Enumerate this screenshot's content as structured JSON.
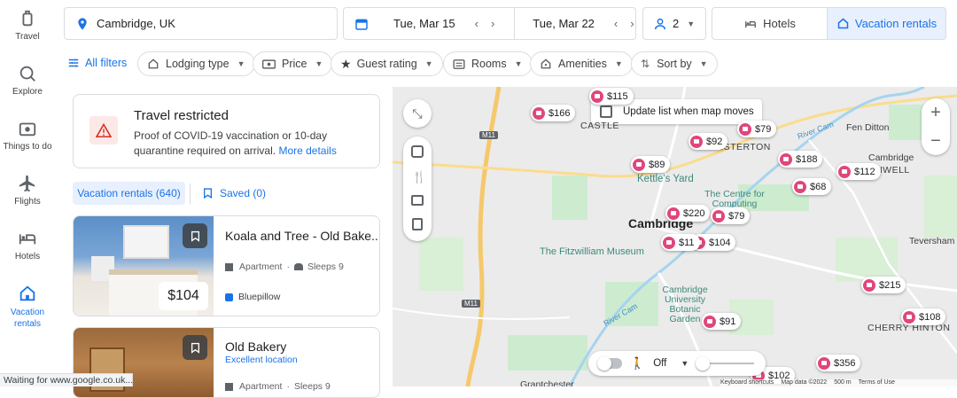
{
  "nav": {
    "items": [
      {
        "label": "Travel",
        "icon": "luggage-icon"
      },
      {
        "label": "Explore",
        "icon": "explore-icon"
      },
      {
        "label": "Things to do",
        "icon": "camera-icon"
      },
      {
        "label": "Flights",
        "icon": "plane-icon"
      },
      {
        "label": "Hotels",
        "icon": "bed-icon"
      },
      {
        "label": "Vacation rentals",
        "icon": "house-icon"
      }
    ]
  },
  "search": {
    "location": "Cambridge, UK",
    "checkin": "Tue, Mar 15",
    "checkout": "Tue, Mar 22",
    "guests": "2"
  },
  "mode_tabs": {
    "hotels": "Hotels",
    "vacation_rentals": "Vacation rentals"
  },
  "filters": {
    "all": "All filters",
    "lodging": "Lodging type",
    "price": "Price",
    "guest_rating": "Guest rating",
    "rooms": "Rooms",
    "amenities": "Amenities",
    "sort": "Sort by"
  },
  "alert": {
    "title": "Travel restricted",
    "body": "Proof of COVID-19 vaccination or 10-day quarantine required on arrival.",
    "link": "More details"
  },
  "list_tabs": {
    "rentals": "Vacation rentals (640)",
    "saved": "Saved (0)"
  },
  "listings": [
    {
      "title": "Koala and Tree - Old Bake...",
      "type": "Apartment",
      "sleeps": "Sleeps 9",
      "source": "Bluepillow",
      "price": "$104"
    },
    {
      "title": "Old Bakery",
      "subtitle": "Excellent location",
      "type": "Apartment",
      "sleeps": "Sleeps 9"
    }
  ],
  "map": {
    "update_list": "Update list when map moves",
    "city_label": "Cambridge",
    "labels": {
      "fen_ditton": "Fen Ditton",
      "cambridge_station": "Cambridge",
      "chesterton": "HESTERTON",
      "castle": "CASTLE",
      "kettles_yard": "Kettle's Yard",
      "computing_history": "The Centre for Computing History",
      "fitzwilliam": "The Fitzwilliam Museum",
      "botanic": "Cambridge University Botanic Garden",
      "teversham": "Teversham",
      "cherry_hinton": "CHERRY HINTON",
      "grantchester": "Grantchester",
      "barnwell": "BARNWELL",
      "river_cam": "River Cam",
      "m11": "M11"
    },
    "prices": [
      "$115",
      "$166",
      "$79",
      "$92",
      "$188",
      "$112",
      "$89",
      "$68",
      "$220",
      "$79",
      "$104",
      "$11",
      "$215",
      "$108",
      "$91",
      "$356",
      "$102"
    ],
    "streetview": "Off",
    "footer": {
      "shortcuts": "Keyboard shortcuts",
      "mapdata": "Map data ©2022",
      "scale": "500 m",
      "terms": "Terms of Use"
    }
  },
  "status_bar": "Waiting for www.google.co.uk...",
  "colors": {
    "accent": "#1a73e8",
    "pin": "#e0467c",
    "alert": "#d93025"
  }
}
